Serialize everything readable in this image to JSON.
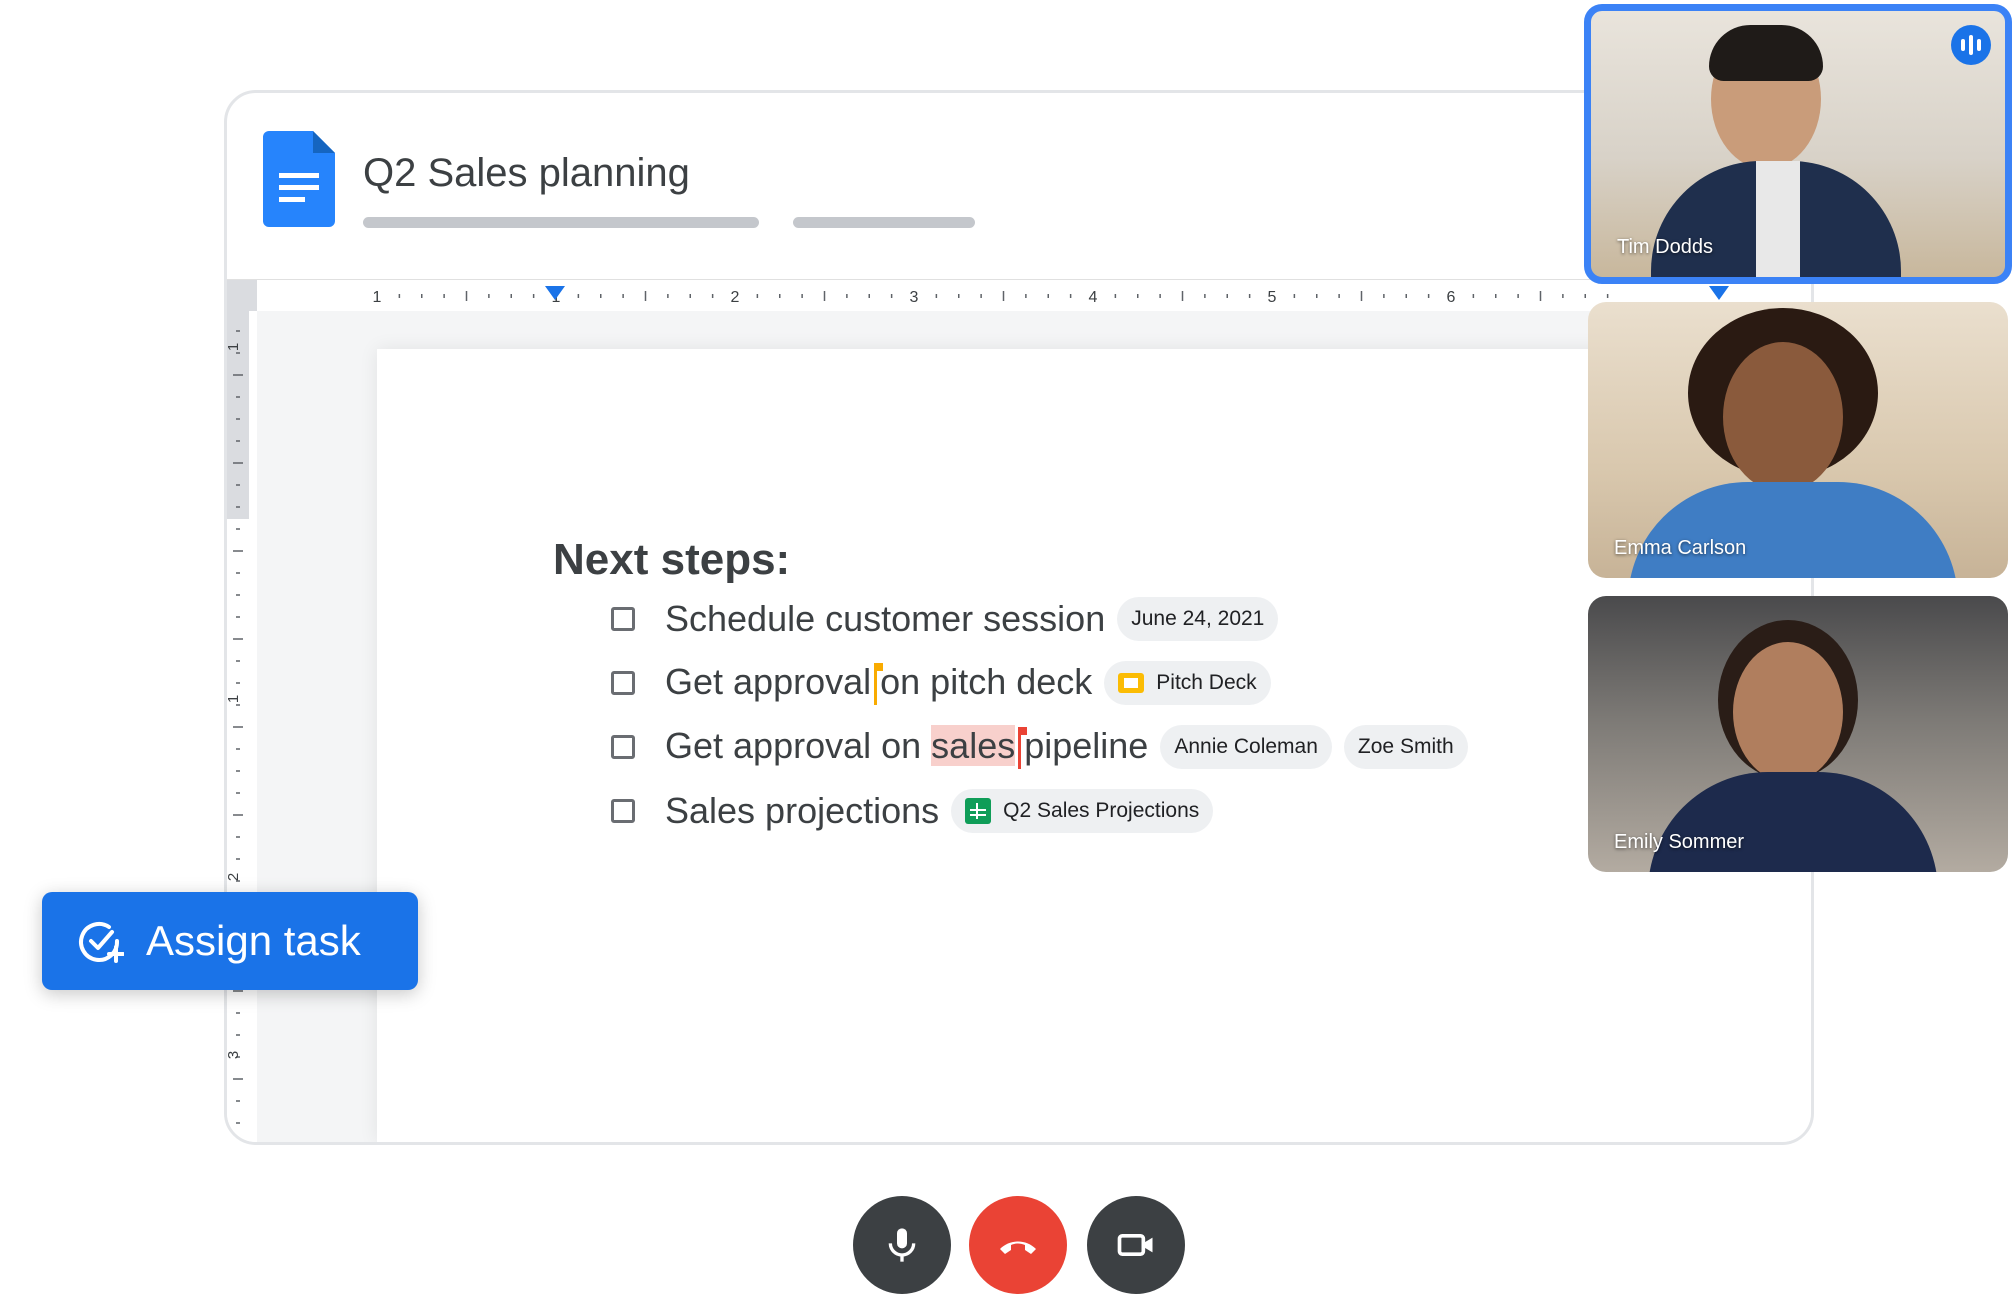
{
  "document": {
    "title": "Q2 Sales planning",
    "doc_icon": "google-docs-icon"
  },
  "ruler": {
    "horizontal_labels": [
      "1",
      "1",
      "2",
      "3",
      "4",
      "5",
      "6"
    ],
    "vertical_labels": [
      "1",
      "1",
      "2",
      "3"
    ]
  },
  "content": {
    "heading": "Next steps:",
    "tasks": [
      {
        "text": "Schedule customer session",
        "chips": [
          {
            "label": "June 24, 2021",
            "icon": ""
          }
        ]
      },
      {
        "text_before": "Get approval",
        "text_after": "on pitch deck",
        "chips": [
          {
            "label": "Pitch Deck",
            "icon": "google-slides-icon"
          }
        ]
      },
      {
        "text_before": "Get approval on ",
        "text_highlight": "sales",
        "text_after": "pipeline",
        "chips": [
          {
            "label": "Annie Coleman",
            "icon": ""
          },
          {
            "label": "Zoe Smith",
            "icon": ""
          }
        ]
      },
      {
        "text": "Sales projections",
        "chips": [
          {
            "label": "Q2 Sales Projections",
            "icon": "google-sheets-icon"
          }
        ]
      }
    ]
  },
  "assign_task": {
    "label": "Assign task",
    "icon": "add-task-icon"
  },
  "participants": [
    {
      "name": "Tim Dodds",
      "active_speaker": true
    },
    {
      "name": "Emma Carlson",
      "active_speaker": false
    },
    {
      "name": "Emily Sommer",
      "active_speaker": false
    }
  ],
  "call_controls": [
    {
      "name": "microphone",
      "icon": "microphone-icon",
      "color": "#3c4043"
    },
    {
      "name": "end-call",
      "icon": "phone-hangup-icon",
      "color": "#ea4335"
    },
    {
      "name": "camera",
      "icon": "video-camera-icon",
      "color": "#3c4043"
    }
  ],
  "colors": {
    "accent": "#1a73e8",
    "danger": "#ea4335",
    "cursor_yellow": "#f9ab00",
    "highlight": "#f8d0cc"
  }
}
